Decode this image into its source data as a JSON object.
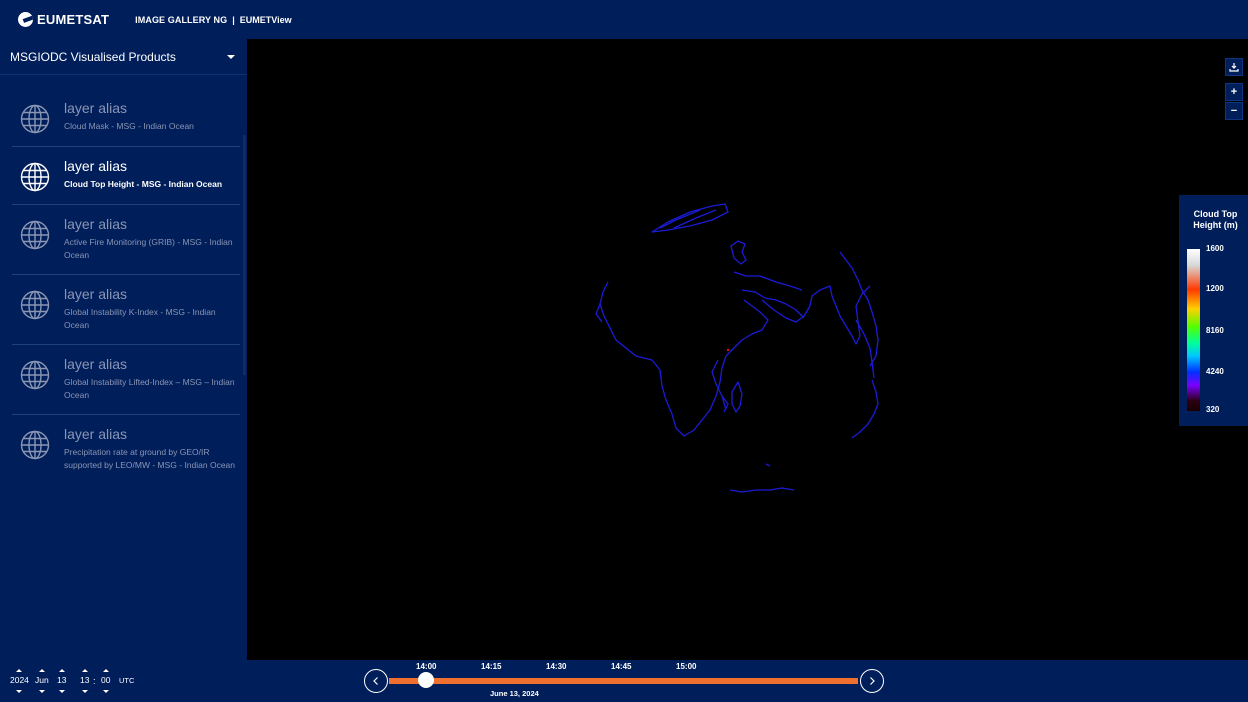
{
  "topbar": {
    "logo_text": "EUMETSAT",
    "app_title": "IMAGE GALLERY NG",
    "separator": "|",
    "view_name": "EUMETView"
  },
  "sidebar": {
    "title": "MSGIODC Visualised Products",
    "layers": [
      {
        "alias": "layer alias",
        "name": "Cloud Mask - MSG - Indian Ocean",
        "active": false
      },
      {
        "alias": "layer alias",
        "name": "Cloud Top Height - MSG - Indian Ocean",
        "active": true
      },
      {
        "alias": "layer alias",
        "name": "Active Fire Monitoring (GRIB) - MSG - Indian Ocean",
        "active": false
      },
      {
        "alias": "layer alias",
        "name": "Global Instability K-Index - MSG - Indian Ocean",
        "active": false
      },
      {
        "alias": "layer alias",
        "name": "Global Instability Lifted-Index – MSG – Indian Ocean",
        "active": false
      },
      {
        "alias": "layer alias",
        "name": "Precipitation rate at ground by GEO/IR supported by LEO/MW - MSG - Indian Ocean",
        "active": false
      }
    ]
  },
  "map_controls": {
    "download_icon": "download-icon",
    "zoom_in": "+",
    "zoom_out": "−"
  },
  "legend": {
    "title_line1": "Cloud Top",
    "title_line2": "Height (m)",
    "ticks": [
      "1600",
      "1200",
      "8160",
      "4240",
      "320"
    ],
    "colors": {
      "top": "#ffffff",
      "high": "#ff3a00",
      "mid": "#53ff00",
      "low": "#0030ff",
      "bottom": "#1a0000"
    }
  },
  "datetime": {
    "year": "2024",
    "month": "Jun",
    "day": "13",
    "hour": "13",
    "separator": ":",
    "minute": "00",
    "timezone": "UTC"
  },
  "timeline": {
    "ticks": [
      "14:00",
      "14:15",
      "14:30",
      "14:45",
      "15:00"
    ],
    "date": "June 13, 2024",
    "track_color": "#f07030"
  }
}
